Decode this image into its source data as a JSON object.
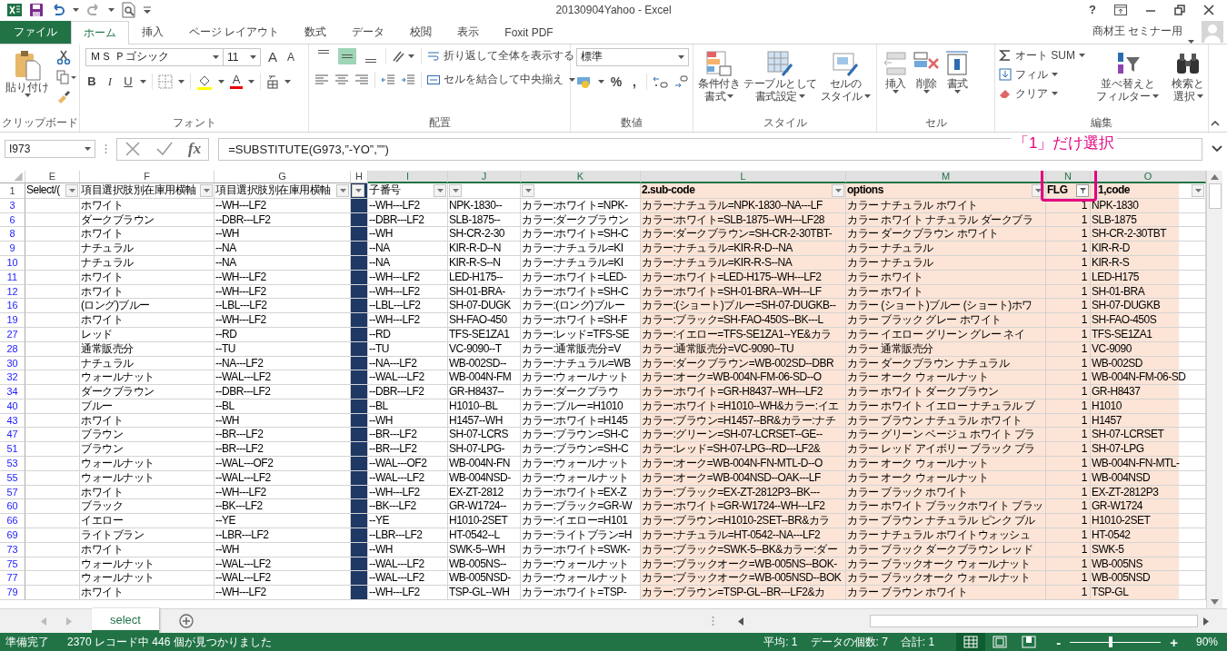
{
  "window": {
    "title": "20130904Yahoo - Excel",
    "help": "?"
  },
  "tabs": [
    {
      "label": "ファイル",
      "kind": "file",
      "selected": false
    },
    {
      "label": "ホーム",
      "kind": "tab",
      "selected": true
    },
    {
      "label": "挿入",
      "kind": "tab",
      "selected": false
    },
    {
      "label": "ページ レイアウト",
      "kind": "tab",
      "selected": false
    },
    {
      "label": "数式",
      "kind": "tab",
      "selected": false
    },
    {
      "label": "データ",
      "kind": "tab",
      "selected": false
    },
    {
      "label": "校閲",
      "kind": "tab",
      "selected": false
    },
    {
      "label": "表示",
      "kind": "tab",
      "selected": false
    },
    {
      "label": "Foxit PDF",
      "kind": "tab",
      "selected": false
    }
  ],
  "user": {
    "name": "商材王 セミナー用"
  },
  "ribbon": {
    "clipboard": {
      "label": "クリップボード",
      "paste": "貼り付け"
    },
    "font": {
      "label": "フォント",
      "name": "ＭＳ Ｐゴシック",
      "size": "11",
      "grow": "A",
      "shrink": "A",
      "bold": "B",
      "italic": "I",
      "underline": "U",
      "font_color": "A"
    },
    "alignment": {
      "label": "配置",
      "vertical_align": [
        {
          "kind": "top",
          "selected": false
        },
        {
          "kind": "middle",
          "selected": true
        },
        {
          "kind": "bottom",
          "selected": false
        }
      ],
      "wrap": "折り返して全体を表示する",
      "merge": "セルを結合して中央揃え"
    },
    "number": {
      "label": "数値",
      "format": "標準",
      "percent": "%",
      "comma": ","
    },
    "styles": {
      "label": "スタイル",
      "buttons": [
        {
          "kind": "conditional",
          "lines": [
            "条件付き",
            "書式"
          ]
        },
        {
          "kind": "table",
          "lines": [
            "テーブルとして",
            "書式設定"
          ]
        },
        {
          "kind": "cell",
          "lines": [
            "セルの",
            "スタイル"
          ]
        }
      ]
    },
    "cells": {
      "label": "セル",
      "buttons": [
        {
          "kind": "insert",
          "label": "挿入"
        },
        {
          "kind": "delete",
          "label": "削除"
        },
        {
          "kind": "format",
          "label": "書式"
        }
      ]
    },
    "editing": {
      "label": "編集",
      "autosum": "オート SUM",
      "fill": "フィル",
      "clear": "クリア",
      "sort": [
        "並べ替えと",
        "フィルター"
      ],
      "find": [
        "検索と",
        "選択"
      ]
    }
  },
  "formula_bar": {
    "name_box": "I973",
    "function_label": "fx",
    "formula": "=SUBSTITUTE(G973,”-YO”,””)"
  },
  "annotation": {
    "text": "「1」だけ選択"
  },
  "sheet": {
    "columns": [
      {
        "letter": "E",
        "selected": false
      },
      {
        "letter": "F",
        "selected": false
      },
      {
        "letter": "G",
        "selected": false
      },
      {
        "letter": "H",
        "selected": false,
        "color": "#1f3864"
      },
      {
        "letter": "I",
        "selected": true
      },
      {
        "letter": "J",
        "selected": true
      },
      {
        "letter": "K",
        "selected": true
      },
      {
        "letter": "L",
        "selected": true,
        "color": "#fce4d6"
      },
      {
        "letter": "M",
        "selected": true,
        "color": "#fce4d6"
      },
      {
        "letter": "N",
        "selected": true,
        "color": "#fce4d6"
      },
      {
        "letter": "O",
        "selected": true,
        "color": "#fce4d6"
      }
    ],
    "header_row": {
      "number": "1",
      "cells": [
        {
          "text": "Select/(",
          "filtered": false
        },
        {
          "text": "項目選択肢別在庫用横軸",
          "filtered": false
        },
        {
          "text": "項目選択肢別在庫用横軸",
          "filtered": false
        },
        {
          "filtered": false
        },
        {
          "text": "子番号",
          "filtered": false
        },
        {
          "filtered": false
        },
        {
          "filtered": false
        },
        {
          "text": "2.sub-code",
          "filtered": false
        },
        {
          "text": "options",
          "filtered": false
        },
        {
          "text": "FLG",
          "filtered": true
        },
        {
          "text": "1,code",
          "filtered": false
        }
      ]
    },
    "rows": [
      {
        "number": "3",
        "f": "ホワイト",
        "g": "--WH---LF2",
        "i": "--WH---LF2",
        "j": "NPK-1830--",
        "k": "カラー:ホワイト=NPK-",
        "l": "カラー:ナチュラル=NPK-1830--NA---LF",
        "m": "カラー ナチュラル ホワイト",
        "n": "1",
        "o": "NPK-1830"
      },
      {
        "number": "6",
        "f": "ダークブラウン",
        "g": "--DBR---LF2",
        "i": "--DBR---LF2",
        "j": "SLB-1875--",
        "k": "カラー:ダークブラウン",
        "l": "カラー:ホワイト=SLB-1875--WH---LF28",
        "m": "カラー ホワイト ナチュラル ダークブラ",
        "n": "1",
        "o": "SLB-1875"
      },
      {
        "number": "8",
        "f": "ホワイト",
        "g": "--WH",
        "i": "--WH",
        "j": "SH-CR-2-30",
        "k": "カラー:ホワイト=SH-C",
        "l": "カラー:ダークブラウン=SH-CR-2-30TBT-",
        "m": "カラー ダークブラウン ホワイト",
        "n": "1",
        "o": "SH-CR-2-30TBT"
      },
      {
        "number": "9",
        "f": "ナチュラル",
        "g": "--NA",
        "i": "--NA",
        "j": "KIR-R-D--N",
        "k": "カラー:ナチュラル=KI",
        "l": "カラー:ナチュラル=KIR-R-D--NA",
        "m": "カラー ナチュラル",
        "n": "1",
        "o": "KIR-R-D"
      },
      {
        "number": "10",
        "f": "ナチュラル",
        "g": "--NA",
        "i": "--NA",
        "j": "KIR-R-S--N",
        "k": "カラー:ナチュラル=KI",
        "l": "カラー:ナチュラル=KIR-R-S--NA",
        "m": "カラー ナチュラル",
        "n": "1",
        "o": "KIR-R-S"
      },
      {
        "number": "11",
        "f": "ホワイト",
        "g": "--WH---LF2",
        "i": "--WH---LF2",
        "j": "LED-H175--",
        "k": "カラー:ホワイト=LED-",
        "l": "カラー:ホワイト=LED-H175--WH---LF2",
        "m": "カラー ホワイト",
        "n": "1",
        "o": "LED-H175"
      },
      {
        "number": "12",
        "f": "ホワイト",
        "g": "--WH---LF2",
        "i": "--WH---LF2",
        "j": "SH-01-BRA-",
        "k": "カラー:ホワイト=SH-C",
        "l": "カラー:ホワイト=SH-01-BRA--WH---LF",
        "m": "カラー ホワイト",
        "n": "1",
        "o": "SH-01-BRA"
      },
      {
        "number": "16",
        "f": "(ロング)ブルー",
        "g": "--LBL---LF2",
        "i": "--LBL---LF2",
        "j": "SH-07-DUGK",
        "k": "カラー:(ロング)ブルー",
        "l": "カラー:(ショート)ブルー=SH-07-DUGKB--",
        "m": "カラー (ショート)ブルー (ショート)ホワ",
        "n": "1",
        "o": "SH-07-DUGKB"
      },
      {
        "number": "19",
        "f": "ホワイト",
        "g": "--WH---LF2",
        "i": "--WH---LF2",
        "j": "SH-FAO-450",
        "k": "カラー:ホワイト=SH-F",
        "l": "カラー:ブラック=SH-FAO-450S--BK---L",
        "m": "カラー ブラック グレー ホワイト",
        "n": "1",
        "o": "SH-FAO-450S"
      },
      {
        "number": "27",
        "f": "レッド",
        "g": "--RD",
        "i": "--RD",
        "j": "TFS-SE1ZA1",
        "k": "カラー:レッド=TFS-SE",
        "l": "カラー:イエロー=TFS-SE1ZA1--YE&カラ",
        "m": "カラー イエロー グリーン グレー ネイ",
        "n": "1",
        "o": "TFS-SE1ZA1"
      },
      {
        "number": "28",
        "f": "通常販売分",
        "g": "--TU",
        "i": "--TU",
        "j": "VC-9090--T",
        "k": "カラー:通常販売分=V",
        "l": "カラー:通常販売分=VC-9090--TU",
        "m": "カラー 通常販売分",
        "n": "1",
        "o": "VC-9090"
      },
      {
        "number": "30",
        "f": "ナチュラル",
        "g": "--NA---LF2",
        "i": "--NA---LF2",
        "j": "WB-002SD--",
        "k": "カラー:ナチュラル=WB",
        "l": "カラー:ダークブラウン=WB-002SD--DBR",
        "m": "カラー ダークブラウン ナチュラル",
        "n": "1",
        "o": "WB-002SD"
      },
      {
        "number": "32",
        "f": "ウォールナット",
        "g": "--WAL---LF2",
        "i": "--WAL---LF2",
        "j": "WB-004N-FM",
        "k": "カラー:ウォールナット",
        "l": "カラー:オーク=WB-004N-FM-06-SD--O",
        "m": "カラー オーク ウォールナット",
        "n": "1",
        "o": "WB-004N-FM-06-SD"
      },
      {
        "number": "34",
        "f": "ダークブラウン",
        "g": "--DBR---LF2",
        "i": "--DBR---LF2",
        "j": "GR-H8437--",
        "k": "カラー:ダークブラウ",
        "l": "カラー:ホワイト=GR-H8437--WH---LF2",
        "m": "カラー ホワイト ダークブラウン",
        "n": "1",
        "o": "GR-H8437"
      },
      {
        "number": "40",
        "f": "ブルー",
        "g": "--BL",
        "i": "--BL",
        "j": "H1010--BL",
        "k": "カラー:ブルー=H1010",
        "l": "カラー:ホワイト=H1010--WH&カラー:イエ",
        "m": "カラー ホワイト イエロー ナチュラル ブ",
        "n": "1",
        "o": "H1010"
      },
      {
        "number": "43",
        "f": "ホワイト",
        "g": "--WH",
        "i": "--WH",
        "j": "H1457--WH",
        "k": "カラー:ホワイト=H145",
        "l": "カラー:ブラウン=H1457--BR&カラー:ナチ",
        "m": "カラー ブラウン ナチュラル ホワイト",
        "n": "1",
        "o": "H1457"
      },
      {
        "number": "47",
        "f": "ブラウン",
        "g": "--BR---LF2",
        "i": "--BR---LF2",
        "j": "SH-07-LCRS",
        "k": "カラー:ブラウン=SH-C",
        "l": "カラー:グリーン=SH-07-LCRSET--GE--",
        "m": "カラー グリーン ベージュ ホワイト ブラ",
        "n": "1",
        "o": "SH-07-LCRSET"
      },
      {
        "number": "51",
        "f": "ブラウン",
        "g": "--BR---LF2",
        "i": "--BR---LF2",
        "j": "SH-07-LPG-",
        "k": "カラー:ブラウン=SH-C",
        "l": "カラー:レッド=SH-07-LPG--RD---LF2&",
        "m": "カラー レッド アイボリー ブラック ブラ",
        "n": "1",
        "o": "SH-07-LPG"
      },
      {
        "number": "53",
        "f": "ウォールナット",
        "g": "--WAL---OF2",
        "i": "--WAL---OF2",
        "j": "WB-004N-FN",
        "k": "カラー:ウォールナット",
        "l": "カラー:オーク=WB-004N-FN-MTL-D--O",
        "m": "カラー オーク ウォールナット",
        "n": "1",
        "o": "WB-004N-FN-MTL-"
      },
      {
        "number": "55",
        "f": "ウォールナット",
        "g": "--WAL---LF2",
        "i": "--WAL---LF2",
        "j": "WB-004NSD-",
        "k": "カラー:ウォールナット",
        "l": "カラー:オーク=WB-004NSD--OAK---LF",
        "m": "カラー オーク ウォールナット",
        "n": "1",
        "o": "WB-004NSD"
      },
      {
        "number": "57",
        "f": "ホワイト",
        "g": "--WH---LF2",
        "i": "--WH---LF2",
        "j": "EX-ZT-2812",
        "k": "カラー:ホワイト=EX-Z",
        "l": "カラー:ブラック=EX-ZT-2812P3--BK---",
        "m": "カラー ブラック ホワイト",
        "n": "1",
        "o": "EX-ZT-2812P3"
      },
      {
        "number": "60",
        "f": "ブラック",
        "g": "--BK---LF2",
        "i": "--BK---LF2",
        "j": "GR-W1724--",
        "k": "カラー:ブラック=GR-W",
        "l": "カラー:ホワイト=GR-W1724--WH---LF2",
        "m": "カラー ホワイト ブラックホワイト ブラッ",
        "n": "1",
        "o": "GR-W1724"
      },
      {
        "number": "66",
        "f": "イエロー",
        "g": "--YE",
        "i": "--YE",
        "j": "H1010-2SET",
        "k": "カラー:イエロー=H101",
        "l": "カラー:ブラウン=H1010-2SET--BR&カラ",
        "m": "カラー ブラウン ナチュラル ピンク ブル",
        "n": "1",
        "o": "H1010-2SET"
      },
      {
        "number": "69",
        "f": "ライトブラン",
        "g": "--LBR---LF2",
        "i": "--LBR---LF2",
        "j": "HT-0542--L",
        "k": "カラー:ライトブラン=H",
        "l": "カラー:ナチュラル=HT-0542--NA---LF2",
        "m": "カラー ナチュラル ホワイトウォッシュ",
        "n": "1",
        "o": "HT-0542"
      },
      {
        "number": "73",
        "f": "ホワイト",
        "g": "--WH",
        "i": "--WH",
        "j": "SWK-5--WH",
        "k": "カラー:ホワイト=SWK-",
        "l": "カラー:ブラック=SWK-5--BK&カラー:ダー",
        "m": "カラー ブラック ダークブラウン レッド",
        "n": "1",
        "o": "SWK-5"
      },
      {
        "number": "75",
        "f": "ウォールナット",
        "g": "--WAL---LF2",
        "i": "--WAL---LF2",
        "j": "WB-005NS--",
        "k": "カラー:ウォールナット",
        "l": "カラー:ブラックオーク=WB-005NS--BOK-",
        "m": "カラー ブラックオーク ウォールナット",
        "n": "1",
        "o": "WB-005NS"
      },
      {
        "number": "77",
        "f": "ウォールナット",
        "g": "--WAL---LF2",
        "i": "--WAL---LF2",
        "j": "WB-005NSD-",
        "k": "カラー:ウォールナット",
        "l": "カラー:ブラックオーク=WB-005NSD--BOK",
        "m": "カラー ブラックオーク ウォールナット",
        "n": "1",
        "o": "WB-005NSD"
      },
      {
        "number": "79",
        "f": "ホワイト",
        "g": "--WH---LF2",
        "i": "--WH---LF2",
        "j": "TSP-GL--WH",
        "k": "カラー:ホワイト=TSP-",
        "l": "カラー:ブラウン=TSP-GL--BR---LF2&カ",
        "m": "カラー ブラウン ホワイト",
        "n": "1",
        "o": "TSP-GL"
      }
    ]
  },
  "sheet_tabs": [
    {
      "label": "select",
      "selected": true
    }
  ],
  "status_bar": {
    "mode": "準備完了",
    "filter_message": "2370 レコード中 446 個が見つかりました",
    "average": "平均: 1",
    "count": "データの個数: 7",
    "sum": "合計: 1",
    "views": [
      {
        "kind": "normal",
        "selected": true
      },
      {
        "kind": "page_layout",
        "selected": false
      },
      {
        "kind": "page_break",
        "selected": false
      }
    ],
    "zoom": {
      "minus": "-",
      "plus": "+",
      "level": 0.45,
      "reading": "90%"
    }
  }
}
